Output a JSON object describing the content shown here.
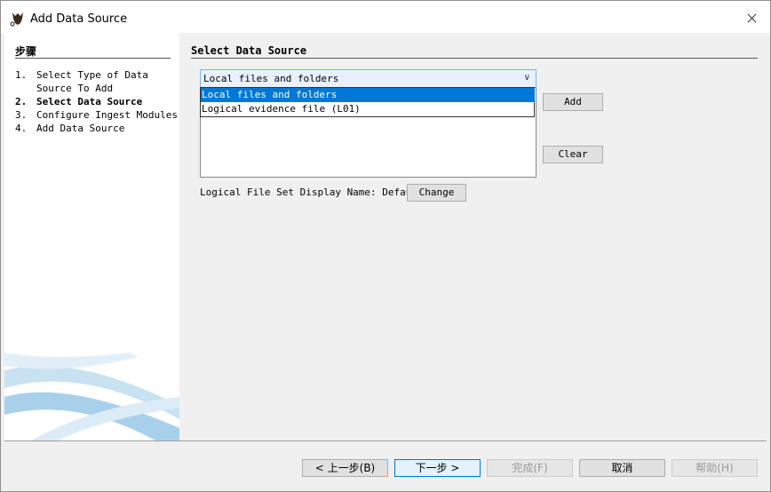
{
  "window": {
    "title": "Add Data Source"
  },
  "steps": {
    "header": "步骤",
    "items": [
      {
        "num": "1.",
        "label": "Select Type of Data Source To Add"
      },
      {
        "num": "2.",
        "label": "Select Data Source"
      },
      {
        "num": "3.",
        "label": "Configure Ingest Modules"
      },
      {
        "num": "4.",
        "label": "Add Data Source"
      }
    ],
    "active_index": 1
  },
  "content": {
    "header": "Select Data Source",
    "source_type": {
      "selected": "Local files and folders",
      "options": [
        "Local files and folders",
        "Logical evidence file (L01)"
      ]
    },
    "add_label": "Add",
    "clear_label": "Clear",
    "display_name_text": "Logical File Set Display Name: Default",
    "change_label": "Change"
  },
  "footer": {
    "back": "< 上一步(B)",
    "next": "下一步 >",
    "finish": "完成(F)",
    "cancel": "取消",
    "help": "帮助(H)"
  },
  "colors": {
    "selection": "#0078d7",
    "combo_bg": "#e8f0fb",
    "dialog_bg": "#f0f0f0"
  }
}
